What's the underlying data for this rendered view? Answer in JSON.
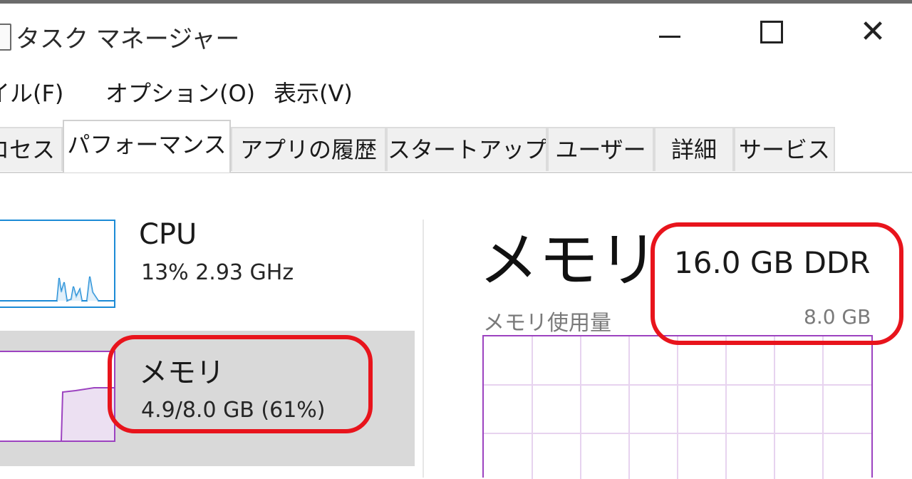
{
  "window": {
    "title": "タスク マネージャー",
    "controls": {
      "close_glyph": "✕"
    }
  },
  "menubar": {
    "items": [
      "イル(F)",
      "オプション(O)",
      "表示(V)"
    ]
  },
  "tabs": [
    {
      "label": "ロセス",
      "active": false
    },
    {
      "label": "パフォーマンス",
      "active": true
    },
    {
      "label": "アプリの履歴",
      "active": false
    },
    {
      "label": "スタートアップ",
      "active": false
    },
    {
      "label": "ユーザー",
      "active": false
    },
    {
      "label": "詳細",
      "active": false
    },
    {
      "label": "サービス",
      "active": false
    }
  ],
  "sidebar": {
    "cpu": {
      "title": "CPU",
      "subtitle": "13%  2.93 GHz",
      "color": "#1c8bd6"
    },
    "memory": {
      "title": "メモリ",
      "subtitle": "4.9/8.0 GB (61%)",
      "color": "#9c43c0",
      "selected": true
    }
  },
  "detail": {
    "title": "メモリ",
    "spec": "16.0 GB DDR",
    "usage_label": "メモリ使用量",
    "max_label": "8.0 GB",
    "graph_color": "#9c43c0"
  },
  "annotations": {
    "color": "#e8141c"
  }
}
